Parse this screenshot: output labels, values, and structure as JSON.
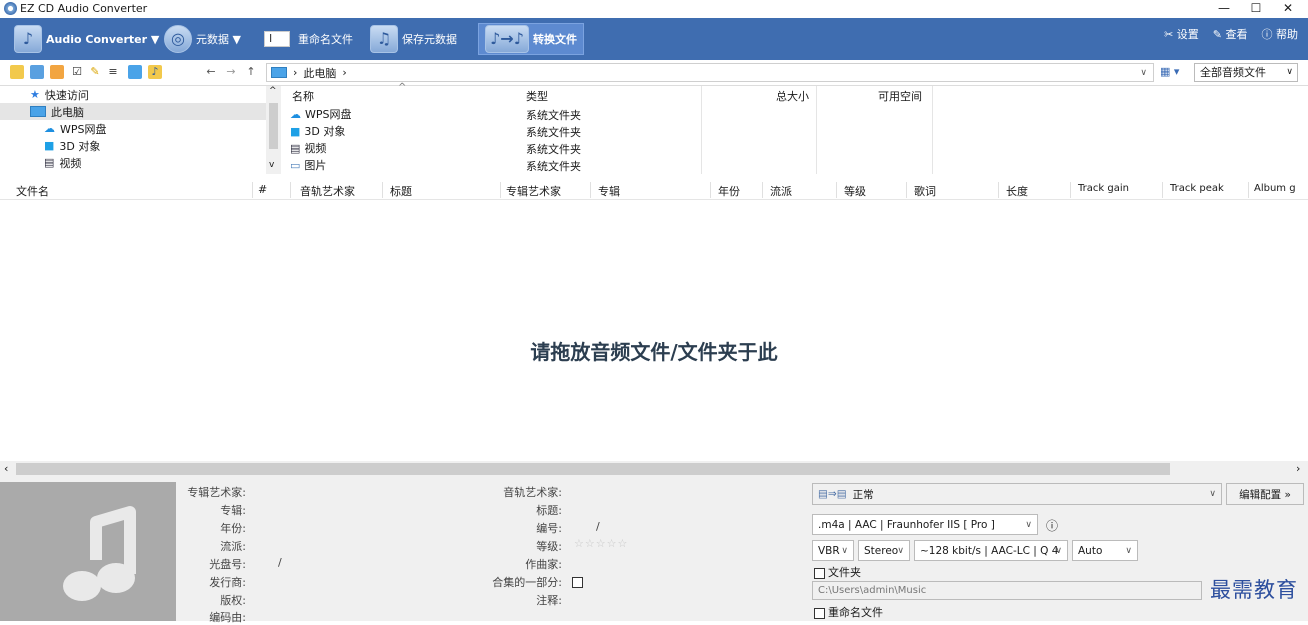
{
  "window": {
    "title": "EZ CD Audio Converter",
    "min": "—",
    "max": "☐",
    "close": "✕"
  },
  "ribbon": {
    "app_menu": "Audio Converter ▼",
    "metadata": "元数据 ▼",
    "rename": "重命名文件",
    "save_meta": "保存元数据",
    "convert": "转换文件",
    "settings": "设置",
    "view": "查看",
    "help": "帮助"
  },
  "toolbar": {
    "nav_back": "←",
    "nav_forward": "→",
    "nav_up": "↑",
    "address": "此电脑",
    "filter": "全部音频文件"
  },
  "tree": [
    {
      "label": "快速访问",
      "icon": "star-icon"
    },
    {
      "label": "此电脑",
      "icon": "computer-icon"
    },
    {
      "label": "WPS网盘",
      "icon": "cloud-icon"
    },
    {
      "label": "3D 对象",
      "icon": "cube-icon"
    },
    {
      "label": "视频",
      "icon": "video-icon"
    }
  ],
  "browser": {
    "headers": {
      "name": "名称",
      "type": "类型",
      "size": "总大小",
      "free": "可用空间"
    },
    "rows": [
      {
        "name": "WPS网盘",
        "type": "系统文件夹"
      },
      {
        "name": "3D 对象",
        "type": "系统文件夹"
      },
      {
        "name": "视频",
        "type": "系统文件夹"
      },
      {
        "name": "图片",
        "type": "系统文件夹"
      }
    ]
  },
  "columns": [
    "文件名",
    "#",
    "音轨艺术家",
    "标题",
    "专辑艺术家",
    "专辑",
    "年份",
    "流派",
    "等级",
    "歌词",
    "长度",
    "Track gain",
    "Track peak",
    "Album g"
  ],
  "drop_hint": "请拖放音频文件/文件夹于此",
  "metadata_left": [
    {
      "label": "专辑艺术家:",
      "value": ""
    },
    {
      "label": "专辑:",
      "value": ""
    },
    {
      "label": "年份:",
      "value": ""
    },
    {
      "label": "流派:",
      "value": ""
    },
    {
      "label": "光盘号:",
      "value": "/"
    },
    {
      "label": "发行商:",
      "value": ""
    },
    {
      "label": "版权:",
      "value": ""
    },
    {
      "label": "编码由:",
      "value": ""
    }
  ],
  "metadata_mid": [
    {
      "label": "音轨艺术家:",
      "value": ""
    },
    {
      "label": "标题:",
      "value": ""
    },
    {
      "label": "编号:",
      "value": "/"
    },
    {
      "label": "等级:",
      "value": "☆☆☆☆☆"
    },
    {
      "label": "作曲家:",
      "value": ""
    },
    {
      "label": "合集的一部分:",
      "value": ""
    },
    {
      "label": "注释:",
      "value": ""
    }
  ],
  "convert": {
    "profile": "正常",
    "edit_profile": "编辑配置 »",
    "format": ".m4a | AAC | Fraunhofer IIS [ Pro ]",
    "mode": "VBR",
    "channels": "Stereo",
    "quality": "~128 kbit/s | AAC-LC | Q 4",
    "rate": "Auto",
    "folder_label": "文件夹",
    "folder_path": "C:\\Users\\admin\\Music",
    "rename_label": "重命名文件"
  },
  "watermark": "最需教育",
  "colors": {
    "ribbon": "#3f6db0",
    "accent": "#2c3e50"
  }
}
